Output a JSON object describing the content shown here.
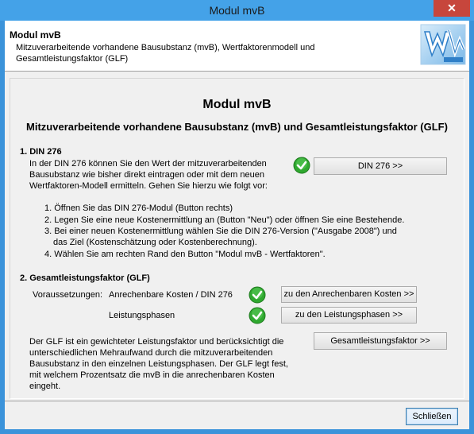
{
  "window": {
    "title": "Modul mvB",
    "close_symbol": "✕"
  },
  "header": {
    "title": "Modul mvB",
    "description": "Mitzuverarbeitende vorhandene Bausubstanz (mvB), Wertfaktorenmodell und Gesamtleistungsfaktor (GLF)"
  },
  "main": {
    "title": "Modul mvB",
    "subtitle": "Mitzuverarbeitende vorhandene Bausubstanz (mvB) und Gesamtleistungsfaktor (GLF)"
  },
  "section1": {
    "heading": "1. DIN 276",
    "intro": "In der DIN 276 können Sie den Wert der mitzuverarbeitenden Bausubstanz wie bisher direkt eintragen oder mit dem neuen Wertfaktoren-Modell ermitteln. Gehen Sie hierzu wie folgt vor:",
    "steps": [
      "1. Öffnen Sie das DIN 276-Modul (Button rechts)",
      "2. Legen Sie eine neue Kostenermittlung an (Button \"Neu\") oder öffnen Sie eine Bestehende.",
      "3. Bei einer neuen Kostenermittlung wählen Sie die DIN 276-Version (\"Ausgabe 2008\") und",
      "das Ziel (Kostenschätzung oder Kostenberechnung).",
      "4. Wählen Sie am rechten Rand den Button \"Modul mvB - Wertfaktoren\"."
    ],
    "button_label": "DIN 276  >>"
  },
  "section2": {
    "heading": "2. Gesamtleistungsfaktor (GLF)",
    "prereq_label": "Voraussetzungen:",
    "prereq1_label": "Anrechenbare Kosten / DIN 276",
    "prereq2_label": "Leistungsphasen",
    "btn_costs": "zu den Anrechenbaren Kosten >>",
    "btn_phases": "zu den Leistungsphasen >>",
    "description": "Der GLF ist ein gewichteter Leistungsfaktor und berücksichtigt die unterschiedlichen Mehraufwand durch die mitzuverarbeitenden Bausubstanz in den einzelnen Leistungsphasen. Der GLF legt fest, mit welchem Prozentsatz die mvB in die anrechenbaren Kosten eingeht.",
    "btn_glf": "Gesamtleistungsfaktor >>"
  },
  "footer": {
    "close_label": "Schließen"
  },
  "colors": {
    "titlebar": "#44a2e8",
    "close_button": "#c7463c",
    "check_green": "#2fa82f"
  },
  "icons": {
    "logo": "w-logo",
    "check": "check-icon"
  }
}
